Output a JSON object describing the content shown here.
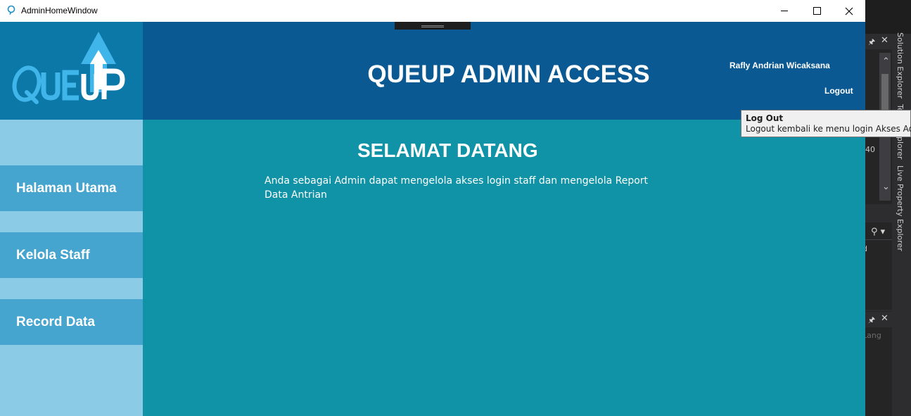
{
  "window": {
    "title": "AdminHomeWindow"
  },
  "header": {
    "logo_text": "QUEUP",
    "title": "QUEUP ADMIN ACCESS",
    "user_name": "Rafly Andrian Wicaksana",
    "logout_label": "Logout"
  },
  "sidebar": {
    "items": [
      {
        "label": "Halaman Utama"
      },
      {
        "label": "Kelola Staff"
      },
      {
        "label": "Record Data"
      }
    ]
  },
  "main": {
    "welcome_title": "SELAMAT DATANG",
    "description": "Anda sebagai Admin dapat mengelola akses login staff dan mengelola Report Data Antrian"
  },
  "tooltip": {
    "title": "Log Out",
    "body": "Logout kembali ke menu login Akses Admin"
  },
  "ide": {
    "tabs": [
      "Solution Explorer",
      "Team Explorer",
      "Live Property Explorer"
    ],
    "partial_text_1": "d",
    "partial_text_2": "Lang",
    "partial_text_3": "40"
  },
  "colors": {
    "logo_bg": "#0b78a8",
    "header_bg": "#0b5992",
    "sidebar_bg": "#8ccbe6",
    "nav_button_bg": "#46a5cf",
    "main_bg": "#1093a7",
    "logo_light_blue": "#3fb5ea"
  }
}
